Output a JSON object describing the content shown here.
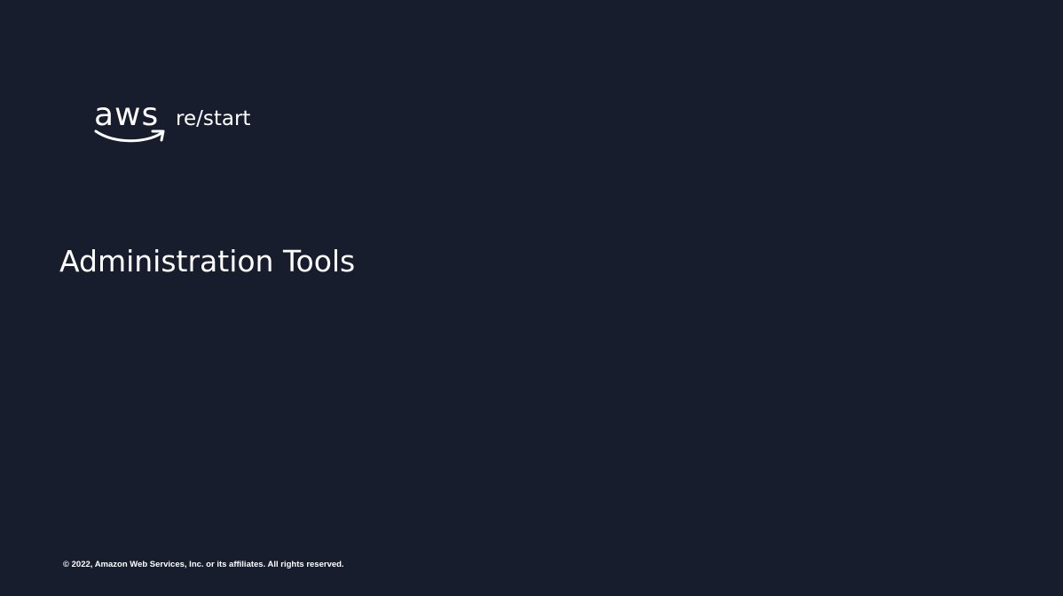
{
  "logo": {
    "mark_text": "aws",
    "product_text": "re/start"
  },
  "slide": {
    "title": "Administration Tools",
    "footer": "© 2022, Amazon Web Services, Inc. or its affiliates. All rights reserved."
  },
  "colors": {
    "background": "#171d2c",
    "text": "#ffffff"
  }
}
